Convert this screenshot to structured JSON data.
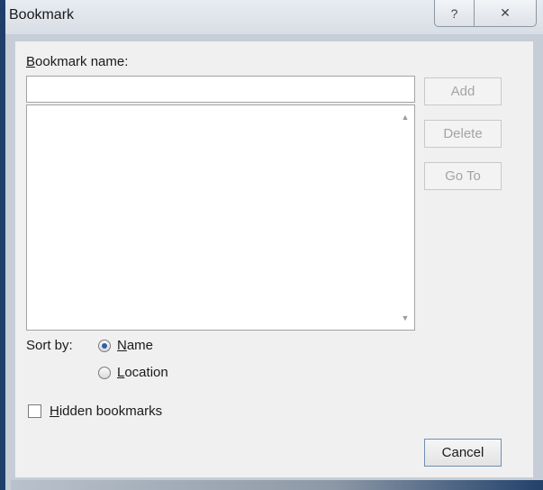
{
  "window": {
    "title": "Bookmark",
    "help_icon": "?",
    "close_icon": "✕"
  },
  "bookmark_name": {
    "label_prefix": "B",
    "label_rest": "ookmark name:",
    "value": ""
  },
  "list": {
    "items": [],
    "scroll_up_icon": "▲",
    "scroll_down_icon": "▼"
  },
  "buttons": {
    "add": "Add",
    "delete": "Delete",
    "goto": "Go To",
    "cancel": "Cancel"
  },
  "sort_by": {
    "label": "Sort by:",
    "options": [
      {
        "underline": "N",
        "rest": "ame",
        "checked": true
      },
      {
        "underline": "L",
        "rest": "ocation",
        "checked": false
      }
    ]
  },
  "hidden_bookmarks": {
    "underline": "H",
    "rest": "idden bookmarks",
    "checked": false
  }
}
